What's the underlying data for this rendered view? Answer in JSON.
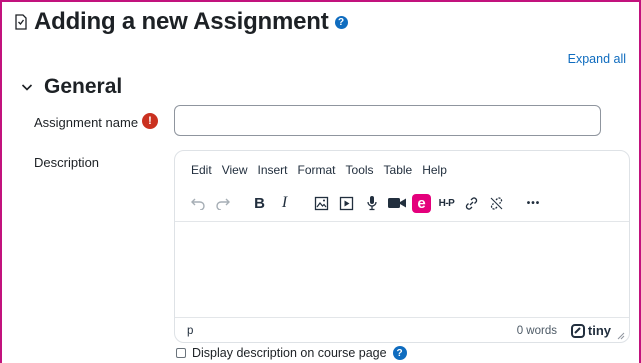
{
  "page": {
    "title": "Adding a new Assignment",
    "help_icon": "?"
  },
  "expand_all": "Expand all",
  "section": {
    "title": "General"
  },
  "fields": {
    "assignment_name": {
      "label": "Assignment name",
      "required_icon": "!",
      "value": ""
    },
    "description": {
      "label": "Description"
    }
  },
  "editor": {
    "menu": [
      "Edit",
      "View",
      "Insert",
      "Format",
      "Tools",
      "Table",
      "Help"
    ],
    "toolbar_icons": [
      "undo-icon",
      "redo-icon",
      "bold-icon",
      "italic-icon",
      "image-icon",
      "media-icon",
      "microphone-icon",
      "video-camera-icon",
      "equella-icon",
      "h5p-icon",
      "link-icon",
      "unlink-icon",
      "more-icon"
    ],
    "toolbar_labels": {
      "bold": "B",
      "italic": "I",
      "h5p": "H-P",
      "more": "•••",
      "equella": "e"
    },
    "status_path": "p",
    "word_count": "0 words",
    "brand": "tiny"
  },
  "display_description": {
    "label": "Display description on course page",
    "checked": false,
    "help_icon": "?"
  },
  "colors": {
    "accent": "#0f6cbf",
    "required": "#ca3120",
    "frame": "#c2127d",
    "equella": "#e4007c"
  }
}
